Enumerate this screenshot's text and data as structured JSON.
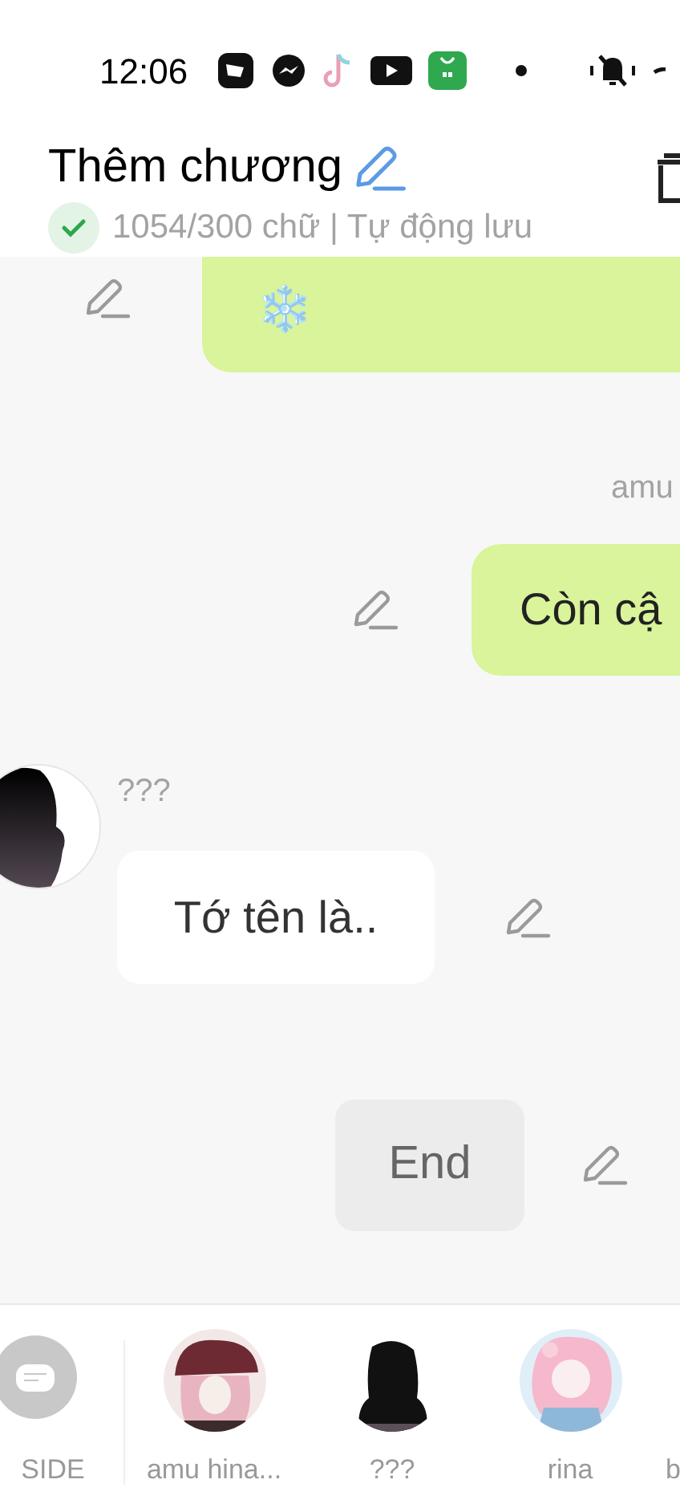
{
  "status_bar": {
    "time": "12:06"
  },
  "header": {
    "title": "Thêm chương",
    "status": "1054/300 chữ | Tự động lưu",
    "saved": true
  },
  "messages": [
    {
      "kind": "right",
      "text": "❄️"
    },
    {
      "kind": "right",
      "sender": "amu",
      "text": "Còn cậ"
    },
    {
      "kind": "left",
      "sender": "???",
      "text": "Tớ tên là.."
    },
    {
      "kind": "end",
      "text": "End"
    }
  ],
  "characters": [
    {
      "kind": "aside",
      "name": "SIDE"
    },
    {
      "kind": "avatar",
      "name": "amu hina..."
    },
    {
      "kind": "avatar",
      "name": "???"
    },
    {
      "kind": "avatar",
      "name": "rina"
    },
    {
      "kind": "edge",
      "name": "b"
    }
  ]
}
